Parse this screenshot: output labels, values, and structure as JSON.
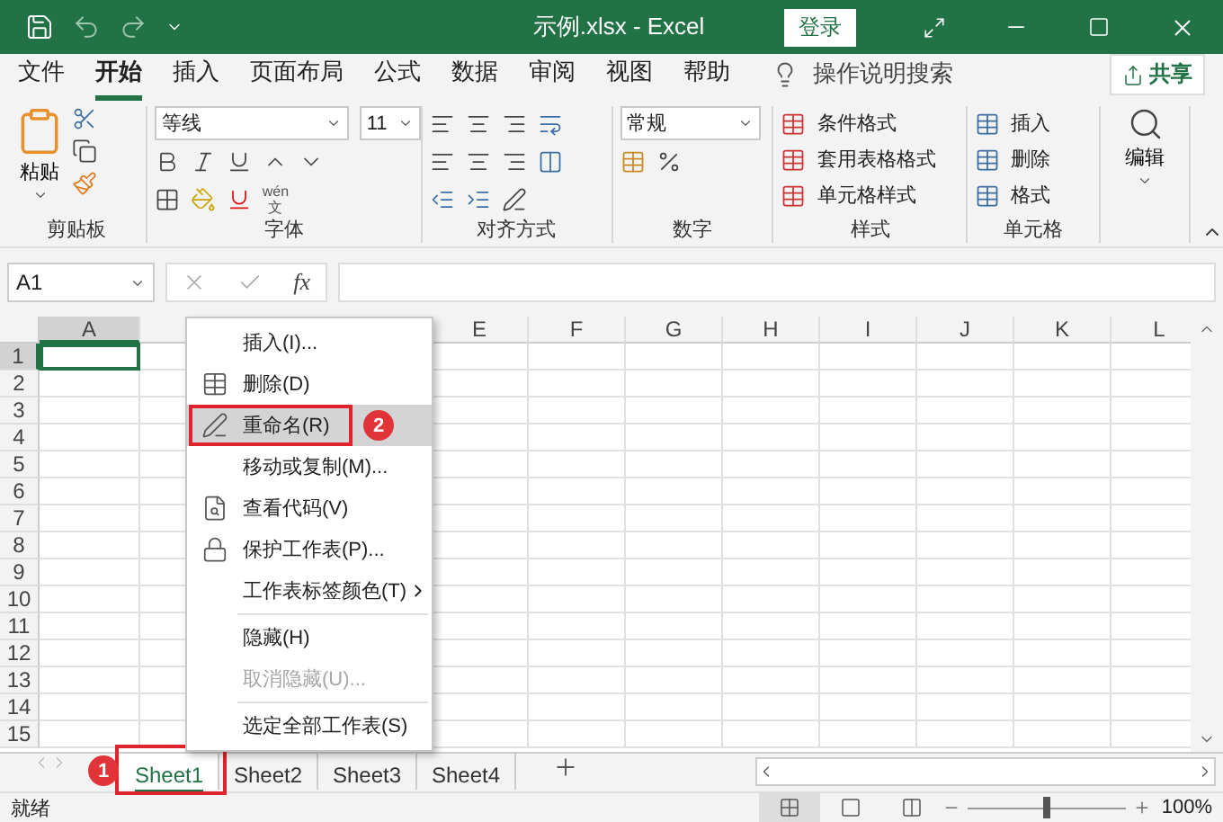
{
  "title_bar": {
    "title": "示例.xlsx  -  Excel",
    "login": "登录"
  },
  "menu_tabs": [
    {
      "label": "文件",
      "selected": false
    },
    {
      "label": "开始",
      "selected": true
    },
    {
      "label": "插入",
      "selected": false
    },
    {
      "label": "页面布局",
      "selected": false
    },
    {
      "label": "公式",
      "selected": false
    },
    {
      "label": "数据",
      "selected": false
    },
    {
      "label": "审阅",
      "selected": false
    },
    {
      "label": "视图",
      "selected": false
    },
    {
      "label": "帮助",
      "selected": false
    }
  ],
  "tell_me": "操作说明搜索",
  "share": "共享",
  "ribbon": {
    "clipboard": {
      "paste": "粘贴",
      "label": "剪贴板"
    },
    "font": {
      "name": "等线",
      "size": "11",
      "label": "字体",
      "phonetic": "wén",
      "phonetic_char": "文"
    },
    "alignment": {
      "label": "对齐方式"
    },
    "number": {
      "format": "常规",
      "label": "数字"
    },
    "styles": {
      "items": [
        "条件格式",
        "套用表格格式",
        "单元格样式"
      ],
      "label": "样式"
    },
    "cells": {
      "items": [
        "插入",
        "删除",
        "格式"
      ],
      "label": "单元格"
    },
    "editing": {
      "label": "编辑"
    }
  },
  "formula_bar": {
    "name_box": "A1",
    "fx": "fx"
  },
  "columns": [
    {
      "label": "A",
      "selected": true
    },
    {
      "label": "E",
      "selected": false
    },
    {
      "label": "F",
      "selected": false
    },
    {
      "label": "G",
      "selected": false
    },
    {
      "label": "H",
      "selected": false
    },
    {
      "label": "I",
      "selected": false
    },
    {
      "label": "J",
      "selected": false
    },
    {
      "label": "K",
      "selected": false
    },
    {
      "label": "L",
      "selected": false
    }
  ],
  "rows": [
    {
      "label": "1",
      "selected": true
    },
    {
      "label": "2",
      "selected": false
    },
    {
      "label": "3",
      "selected": false
    },
    {
      "label": "4",
      "selected": false
    },
    {
      "label": "5",
      "selected": false
    },
    {
      "label": "6",
      "selected": false
    },
    {
      "label": "7",
      "selected": false
    },
    {
      "label": "8",
      "selected": false
    },
    {
      "label": "9",
      "selected": false
    },
    {
      "label": "10",
      "selected": false
    },
    {
      "label": "11",
      "selected": false
    },
    {
      "label": "12",
      "selected": false
    },
    {
      "label": "13",
      "selected": false
    },
    {
      "label": "14",
      "selected": false
    },
    {
      "label": "15",
      "selected": false
    }
  ],
  "context_menu": {
    "items": [
      {
        "label": "插入(I)...",
        "selected": false,
        "disabled": false,
        "submenu": false,
        "separator_before": false
      },
      {
        "label": "删除(D)",
        "selected": false,
        "disabled": false,
        "submenu": false,
        "separator_before": false
      },
      {
        "label": "重命名(R)",
        "selected": true,
        "disabled": false,
        "submenu": false,
        "separator_before": false,
        "badge": "2"
      },
      {
        "label": "移动或复制(M)...",
        "selected": false,
        "disabled": false,
        "submenu": false,
        "separator_before": false
      },
      {
        "label": "查看代码(V)",
        "selected": false,
        "disabled": false,
        "submenu": false,
        "separator_before": false
      },
      {
        "label": "保护工作表(P)...",
        "selected": false,
        "disabled": false,
        "submenu": false,
        "separator_before": false
      },
      {
        "label": "工作表标签颜色(T)",
        "selected": false,
        "disabled": false,
        "submenu": true,
        "separator_before": false
      },
      {
        "label": "隐藏(H)",
        "selected": false,
        "disabled": false,
        "submenu": false,
        "separator_before": true
      },
      {
        "label": "取消隐藏(U)...",
        "selected": false,
        "disabled": true,
        "submenu": false,
        "separator_before": false
      },
      {
        "label": "选定全部工作表(S)",
        "selected": false,
        "disabled": false,
        "submenu": false,
        "separator_before": true
      }
    ]
  },
  "sheet_tabs": [
    {
      "label": "Sheet1",
      "selected": true,
      "badge": "1"
    },
    {
      "label": "Sheet2",
      "selected": false
    },
    {
      "label": "Sheet3",
      "selected": false
    },
    {
      "label": "Sheet4",
      "selected": false
    }
  ],
  "status_bar": {
    "status": "就绪",
    "zoom": "100%",
    "zoom_level": {
      "level": 0.5
    }
  }
}
